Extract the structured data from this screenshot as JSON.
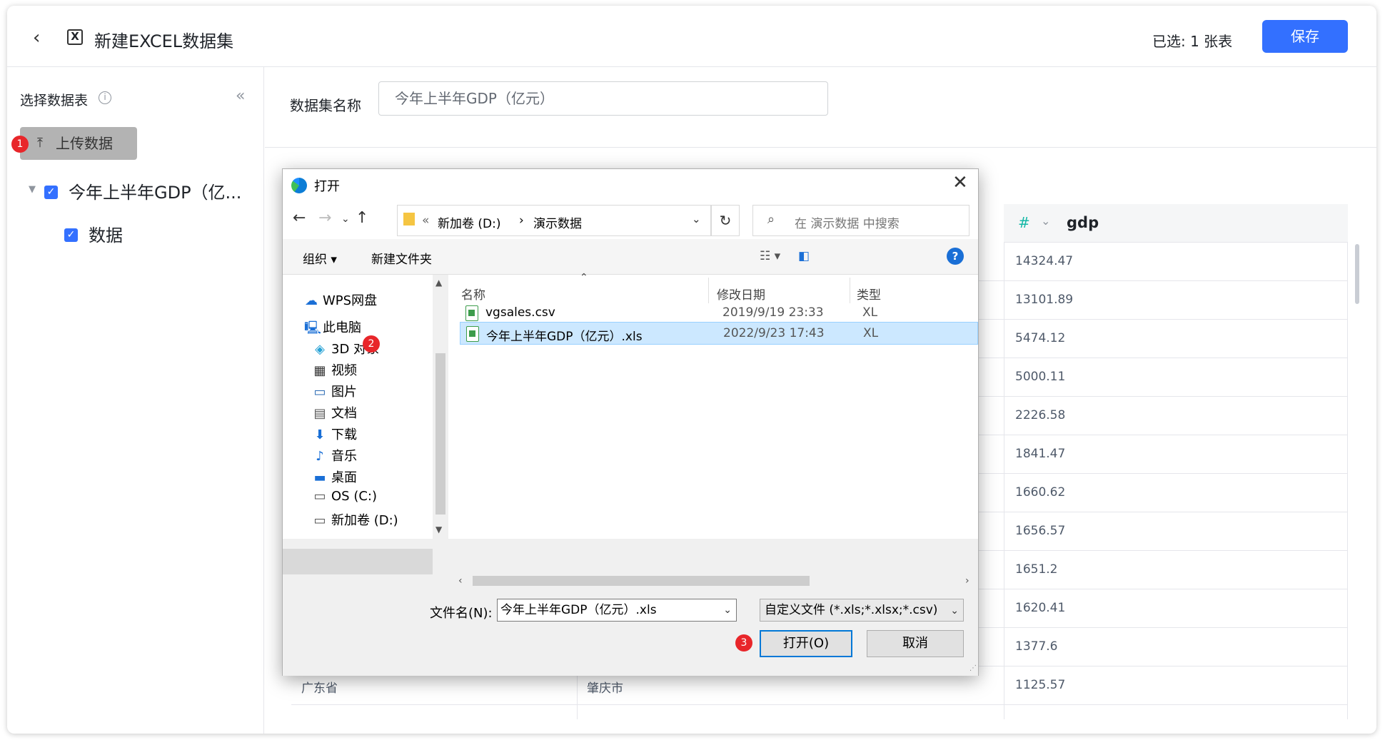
{
  "header": {
    "title": "新建EXCEL数据集",
    "selected_text": "已选:  1 张表",
    "save_label": "保存"
  },
  "sidebar": {
    "title": "选择数据表",
    "upload_label": "上传数据",
    "tree": [
      {
        "label": "今年上半年GDP（亿...",
        "checked": true
      },
      {
        "label": "数据",
        "checked": true
      }
    ]
  },
  "main": {
    "dataset_name_label": "数据集名称",
    "dataset_name_value": "今年上半年GDP（亿元）",
    "column": {
      "type_icon": "#",
      "name": "gdp"
    },
    "rows": [
      {
        "gdp": "14324.47"
      },
      {
        "gdp": "13101.89"
      },
      {
        "gdp": "5474.12"
      },
      {
        "gdp": "5000.11"
      },
      {
        "gdp": "2226.58"
      },
      {
        "gdp": "1841.47"
      },
      {
        "gdp": "1660.62"
      },
      {
        "gdp": "1656.57"
      },
      {
        "gdp": "1651.2"
      },
      {
        "gdp": "1620.41"
      },
      {
        "gdp": "1377.6"
      },
      {
        "province": "广东省",
        "city": "肇庆市",
        "gdp": "1125.57"
      }
    ]
  },
  "badges": [
    "1",
    "2",
    "3"
  ],
  "dialog": {
    "title": "打开",
    "address": {
      "prefix": "«",
      "part1": "新加卷 (D:)",
      "sep": "›",
      "part2": "演示数据"
    },
    "search_placeholder": "在 演示数据 中搜索",
    "toolbar": {
      "organize": "组织 ▾",
      "new_folder": "新建文件夹"
    },
    "nav": [
      {
        "icon": "cloud-icon",
        "glyph": "☁",
        "label": "WPS网盘"
      },
      {
        "icon": "computer-icon",
        "glyph": "🖳",
        "label": "此电脑"
      },
      {
        "icon": "cube-icon",
        "glyph": "◈",
        "label": "3D 对象"
      },
      {
        "icon": "video-icon",
        "glyph": "▦",
        "label": "视频"
      },
      {
        "icon": "picture-icon",
        "glyph": "▭",
        "label": "图片"
      },
      {
        "icon": "document-icon",
        "glyph": "▤",
        "label": "文档"
      },
      {
        "icon": "download-icon",
        "glyph": "⬇",
        "label": "下载"
      },
      {
        "icon": "music-icon",
        "glyph": "♪",
        "label": "音乐"
      },
      {
        "icon": "desktop-icon",
        "glyph": "▬",
        "label": "桌面"
      },
      {
        "icon": "drive-icon",
        "glyph": "▭",
        "label": "OS (C:)"
      },
      {
        "icon": "drive-icon",
        "glyph": "▭",
        "label": "新加卷 (D:)"
      }
    ],
    "columns": {
      "name": "名称",
      "date": "修改日期",
      "type": "类型"
    },
    "files": [
      {
        "name": "vgsales.csv",
        "date": "2019/9/19 23:33",
        "type": "XL",
        "selected": false
      },
      {
        "name": "今年上半年GDP（亿元）.xls",
        "date": "2022/9/23 17:43",
        "type": "XL",
        "selected": true
      }
    ],
    "filename_label": "文件名(N):",
    "filename_value": "今年上半年GDP（亿元）.xls",
    "filetype": "自定义文件 (*.xls;*.xlsx;*.csv)",
    "open_label": "打开(O)",
    "cancel_label": "取消"
  },
  "colors": {
    "accent": "#3370ff",
    "badge": "#e8262a",
    "selection": "#cce8ff"
  }
}
